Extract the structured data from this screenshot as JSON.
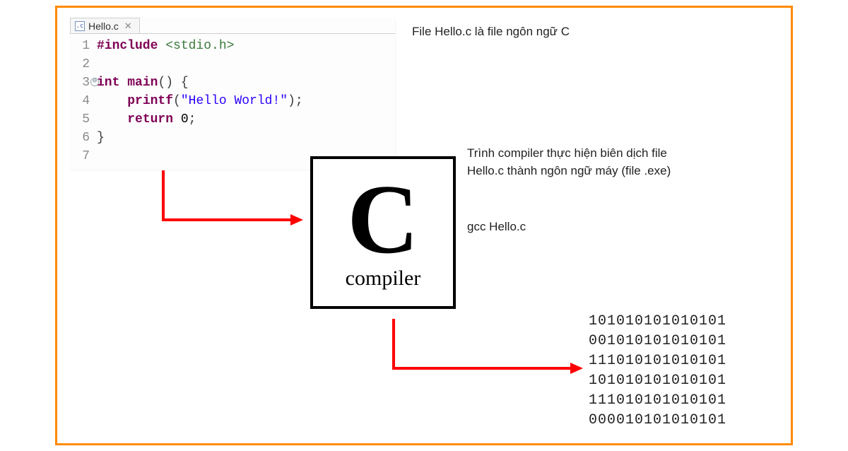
{
  "editor": {
    "tab_filename": "Hello.c",
    "file_icon_text": ".c",
    "close_glyph": "✕",
    "lines": [
      {
        "n": "1",
        "tokens": [
          [
            "kw",
            "#include "
          ],
          [
            "incfile",
            "<stdio.h>"
          ]
        ]
      },
      {
        "n": "2",
        "tokens": []
      },
      {
        "n": "3",
        "fold": true,
        "tokens": [
          [
            "kw",
            "int "
          ],
          [
            "kw",
            "main"
          ],
          [
            "inc",
            "() {"
          ]
        ]
      },
      {
        "n": "4",
        "tokens": [
          [
            "inc",
            "    "
          ],
          [
            "kw",
            "printf"
          ],
          [
            "inc",
            "("
          ],
          [
            "str",
            "\"Hello World!\""
          ],
          [
            "inc",
            ");"
          ]
        ]
      },
      {
        "n": "5",
        "tokens": [
          [
            "inc",
            "    "
          ],
          [
            "kw",
            "return "
          ],
          [
            "num",
            "0"
          ],
          [
            "inc",
            ";"
          ]
        ]
      },
      {
        "n": "6",
        "tokens": [
          [
            "inc",
            "}"
          ]
        ]
      },
      {
        "n": "7",
        "tokens": []
      }
    ]
  },
  "annotations": {
    "top": "File Hello.c là file ngôn ngữ C",
    "mid": "Trình compiler thực hiện biên dịch file Hello.c thành ngôn ngữ máy (file .exe)",
    "gcc": "gcc Hello.c"
  },
  "compiler": {
    "letter": "C",
    "label": "compiler"
  },
  "binary_lines": [
    "101010101010101",
    "001010101010101",
    "111010101010101",
    "101010101010101",
    "111010101010101",
    "000010101010101"
  ],
  "fold_marker_glyph": "⊖"
}
